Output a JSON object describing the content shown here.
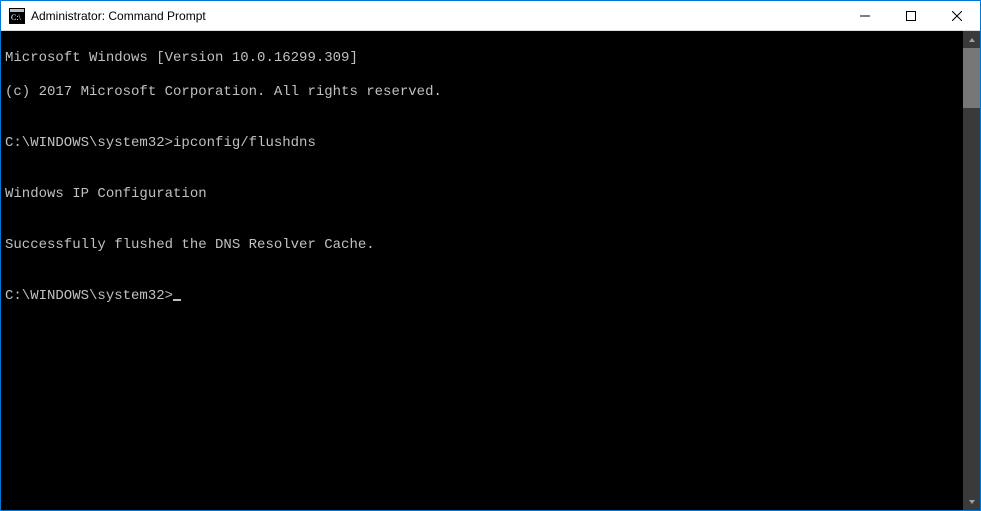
{
  "window": {
    "title": "Administrator: Command Prompt"
  },
  "console": {
    "line1": "Microsoft Windows [Version 10.0.16299.309]",
    "line2": "(c) 2017 Microsoft Corporation. All rights reserved.",
    "blank1": "",
    "prompt1_path": "C:\\WINDOWS\\system32>",
    "prompt1_cmd": "ipconfig/flushdns",
    "blank2": "",
    "out1": "Windows IP Configuration",
    "blank3": "",
    "out2": "Successfully flushed the DNS Resolver Cache.",
    "blank4": "",
    "prompt2_path": "C:\\WINDOWS\\system32>"
  }
}
